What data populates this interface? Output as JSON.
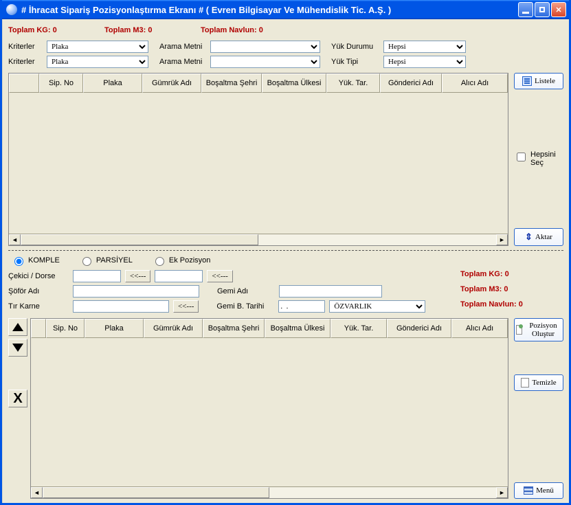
{
  "window": {
    "title": "# İhracat Sipariş Pozisyonlaştırma Ekranı #   ( Evren Bilgisayar Ve Mühendislik Tic. A.Ş. )"
  },
  "totals": {
    "kg_label": "Toplam KG: 0",
    "m3_label": "Toplam M3: 0",
    "navlun_label": "Toplam Navlun: 0"
  },
  "filters": {
    "kriterler_label": "Kriterler",
    "kriter1": "Plaka",
    "kriter2": "Plaka",
    "arama_label": "Arama Metni",
    "arama1": "",
    "arama2": "",
    "yuk_durumu_label": "Yük Durumu",
    "yuk_durumu": "Hepsi",
    "yuk_tipi_label": "Yük Tipi",
    "yuk_tipi": "Hepsi"
  },
  "grid1": {
    "cols": [
      "",
      "Sip. No",
      "Plaka",
      "Gümrük Adı",
      "Boşaltma Şehri",
      "Boşaltma Ülkesi",
      "Yük. Tar.",
      "Gönderici Adı",
      "Alıcı Adı"
    ]
  },
  "side": {
    "listele": "Listele",
    "hepsini_sec": "Hepsini Seç",
    "aktar": "Aktar",
    "pozisyon": "Pozisyon Oluştur",
    "temizle": "Temizle",
    "menu": "Menü"
  },
  "radios": {
    "komple": "KOMPLE",
    "parsiyel": "PARSİYEL",
    "ek": "Ek Pozisyon"
  },
  "form": {
    "cekici_label": "Çekici / Dorse",
    "sofor_label": "Şöför Adı",
    "tir_label": "Tır Karne",
    "gemi_label": "Gemi Adı",
    "gemib_label": "Gemi B. Tarihi",
    "gemib_val": ".  .",
    "ozv": "ÖZVARLIK",
    "arrow_btn": "<<---"
  },
  "totals2": {
    "kg": "Toplam KG: 0",
    "m3": "Toplam M3: 0",
    "navlun": "Toplam Navlun: 0"
  },
  "grid2": {
    "cols": [
      "",
      "Sip. No",
      "Plaka",
      "Gümrük Adı",
      "Boşaltma Şehri",
      "Boşaltma Ülkesi",
      "Yük. Tar.",
      "Gönderici Adı",
      "Alıcı Adı"
    ]
  }
}
